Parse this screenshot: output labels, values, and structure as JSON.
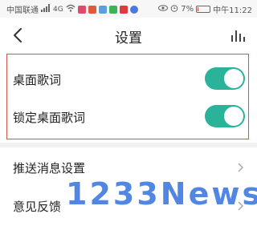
{
  "status_bar": {
    "carrier": "中国联通",
    "network": "4G",
    "battery": "7%",
    "time": "中午11:22",
    "battery_level": 0.07
  },
  "header": {
    "title": "设置"
  },
  "settings": {
    "desktop_lyrics": {
      "label": "桌面歌词",
      "enabled": true
    },
    "lock_desktop_lyrics": {
      "label": "锁定桌面歌词",
      "enabled": true
    },
    "push_settings": {
      "label": "推送消息设置"
    },
    "feedback": {
      "label": "意见反馈"
    }
  },
  "colors": {
    "toggle_on": "#2bb39a",
    "highlight_border": "#d9534f",
    "watermark": "#3f7be0"
  },
  "watermark": "1233News"
}
